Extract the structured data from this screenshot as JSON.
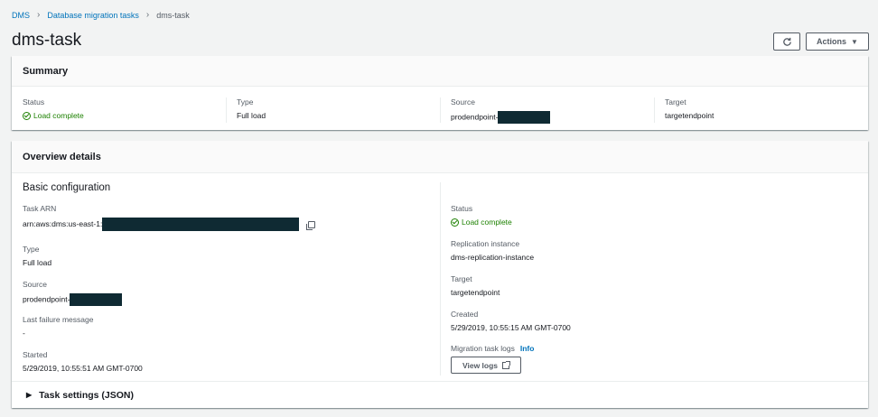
{
  "breadcrumb": {
    "items": [
      "DMS",
      "Database migration tasks",
      "dms-task"
    ]
  },
  "header": {
    "title": "dms-task",
    "actions_label": "Actions"
  },
  "summary": {
    "title": "Summary",
    "status_label": "Status",
    "status_value": "Load complete",
    "type_label": "Type",
    "type_value": "Full load",
    "source_label": "Source",
    "source_value": "prodendpoint-",
    "target_label": "Target",
    "target_value": "targetendpoint"
  },
  "overview": {
    "title": "Overview details",
    "basic_title": "Basic configuration",
    "left": {
      "arn_label": "Task ARN",
      "arn_value": "arn:aws:dms:us-east-1:",
      "type_label": "Type",
      "type_value": "Full load",
      "source_label": "Source",
      "source_value": "prodendpoint-",
      "failure_label": "Last failure message",
      "failure_value": "-",
      "started_label": "Started",
      "started_value": "5/29/2019, 10:55:51 AM GMT-0700"
    },
    "right": {
      "status_label": "Status",
      "status_value": "Load complete",
      "instance_label": "Replication instance",
      "instance_value": "dms-replication-instance",
      "target_label": "Target",
      "target_value": "targetendpoint",
      "created_label": "Created",
      "created_value": "5/29/2019, 10:55:15 AM GMT-0700",
      "logs_label": "Migration task logs",
      "info_label": "Info",
      "view_logs_label": "View logs"
    },
    "task_settings_label": "Task settings (JSON)"
  },
  "colors": {
    "link": "#0073bb",
    "success": "#1d8102",
    "redaction": "#0f2a33"
  },
  "icons": [
    "chevron-right-icon",
    "refresh-icon",
    "caret-down-icon",
    "status-ok-icon",
    "copy-icon",
    "external-link-icon",
    "expand-triangle-icon"
  ]
}
